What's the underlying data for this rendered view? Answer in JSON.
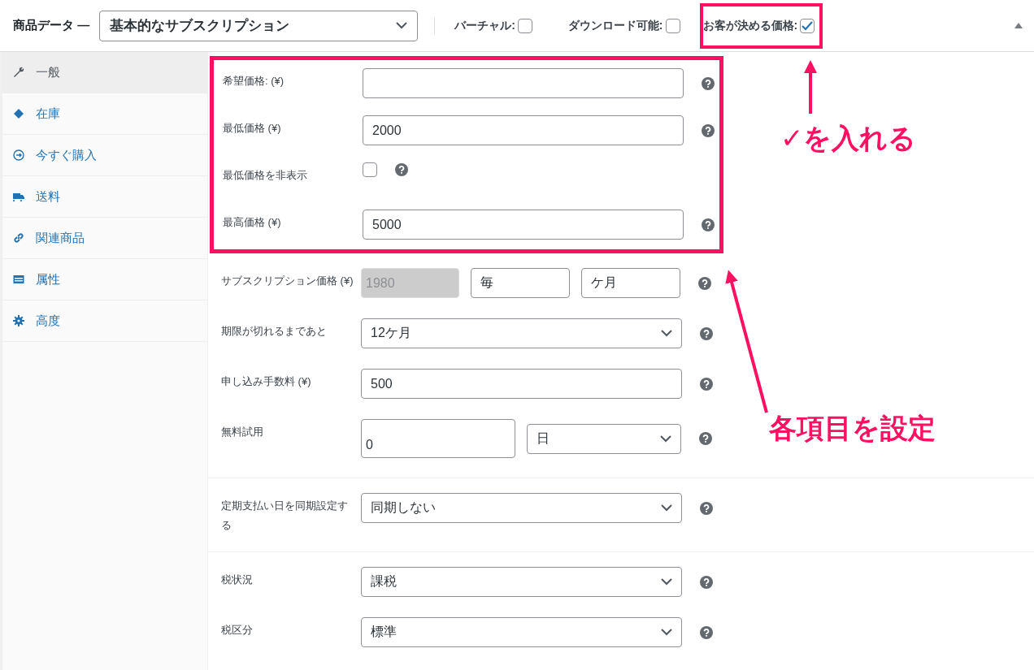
{
  "header": {
    "title": "商品データ —",
    "product_type": "基本的なサブスクリプション",
    "options": [
      {
        "label": "バーチャル:",
        "checked": false,
        "highlighted": false
      },
      {
        "label": "ダウンロード可能:",
        "checked": false,
        "highlighted": false
      },
      {
        "label": "お客が決める価格:",
        "checked": true,
        "highlighted": true
      }
    ]
  },
  "sidebar": {
    "items": [
      {
        "label": "一般",
        "selected": true
      },
      {
        "label": "在庫",
        "selected": false
      },
      {
        "label": "今すぐ購入",
        "selected": false
      },
      {
        "label": "送料",
        "selected": false
      },
      {
        "label": "関連商品",
        "selected": false
      },
      {
        "label": "属性",
        "selected": false
      },
      {
        "label": "高度",
        "selected": false
      }
    ]
  },
  "sections": [
    {
      "highlighted": true,
      "rows": [
        {
          "kind": "text",
          "label": "希望価格: (¥)",
          "value": ""
        },
        {
          "kind": "text",
          "label": "最低価格 (¥)",
          "value": "2000"
        },
        {
          "kind": "checkbox",
          "label": "最低価格を非表示",
          "checked": false
        },
        {
          "kind": "text",
          "label": "最高価格 (¥)",
          "value": "5000"
        }
      ]
    },
    {
      "highlighted": false,
      "rows": [
        {
          "kind": "subscription",
          "label": "サブスクリプション価格 (¥)",
          "value": "1980",
          "period_prefix": "毎",
          "period": "ケ月"
        },
        {
          "kind": "select",
          "label": "期限が切れるまであと",
          "value": "12ケ月"
        },
        {
          "kind": "text",
          "label": "申し込み手数料 (¥)",
          "value": "500"
        },
        {
          "kind": "trial",
          "label": "無料試用",
          "value": "0",
          "unit": "日"
        }
      ]
    },
    {
      "highlighted": false,
      "rows": [
        {
          "kind": "select",
          "label": "定期支払い日を同期設定する",
          "value": "同期しない"
        }
      ]
    },
    {
      "highlighted": false,
      "rows": [
        {
          "kind": "select",
          "label": "税状況",
          "value": "課税"
        },
        {
          "kind": "select",
          "label": "税区分",
          "value": "標準"
        }
      ]
    }
  ],
  "callouts": [
    {
      "text": "✓を入れる"
    },
    {
      "text": "各項目を設定"
    }
  ]
}
